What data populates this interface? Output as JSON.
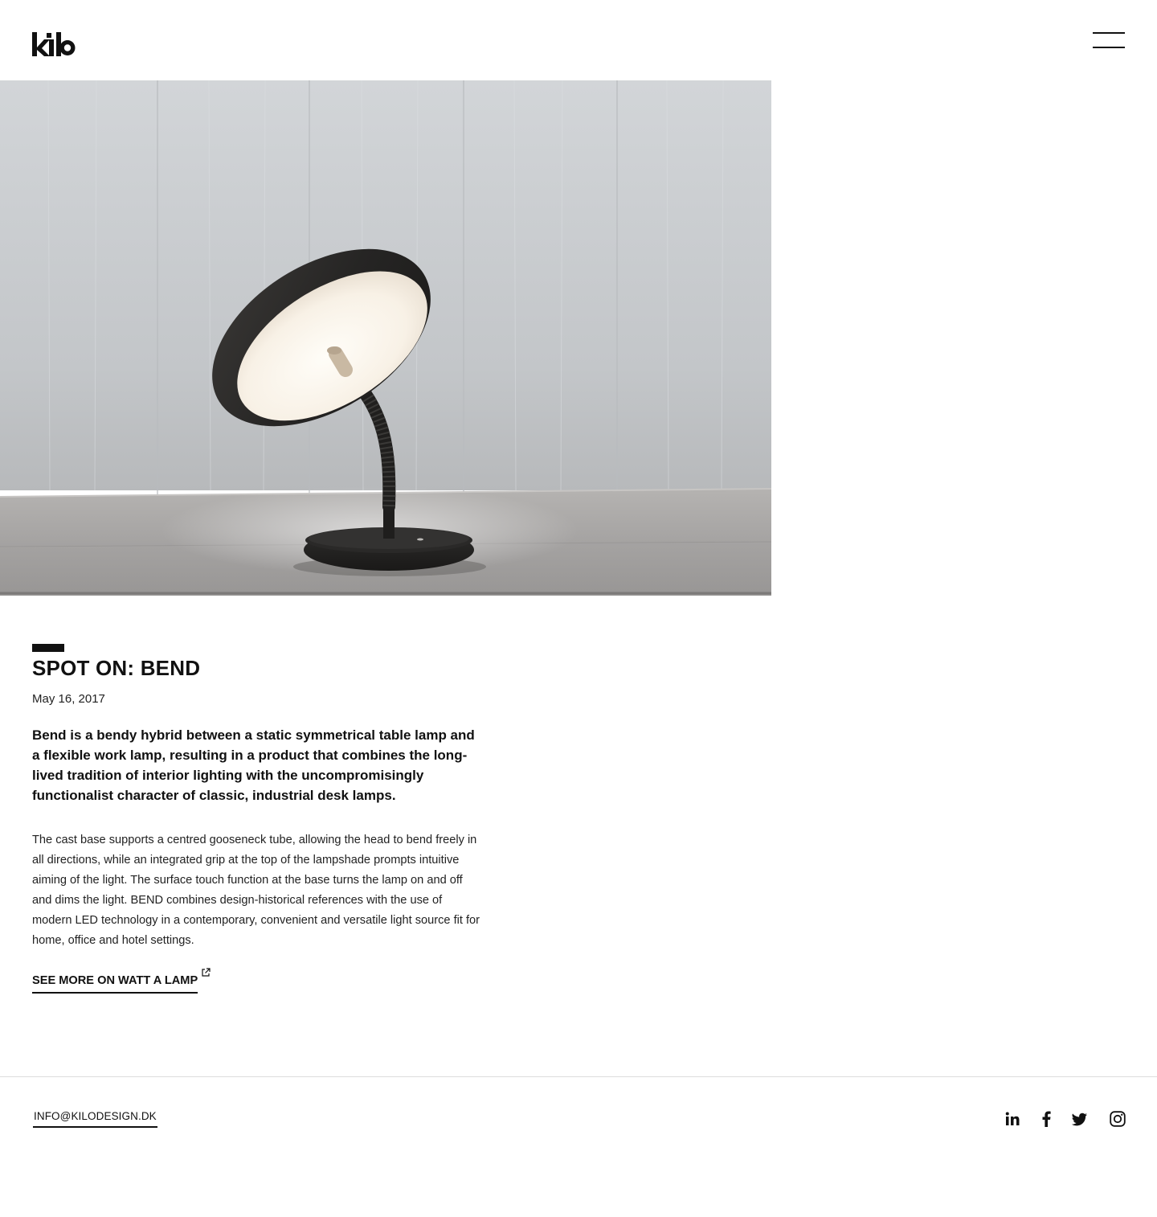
{
  "header": {
    "logo_text": "kilo",
    "menu_icon": "hamburger-icon"
  },
  "hero": {
    "image_subject": "black table lamp with gooseneck"
  },
  "article": {
    "title": "SPOT ON: BEND",
    "date": "May 16, 2017",
    "lead": "Bend is a bendy hybrid between a static symmetrical table lamp and a flexible work lamp, resulting in a product that combines the long-lived tradition of interior lighting with the uncompromisingly functionalist character of classic, industrial desk lamps.",
    "body": "The cast base supports a centred gooseneck tube, allowing the head to bend freely in all directions, while an integrated grip at the top of the lampshade prompts intuitive aiming of the light. The surface touch function at the base turns the lamp on and off and dims the light. BEND combines design-historical references with the use of modern LED technology in a contemporary, convenient and versatile light source fit for home, office and hotel settings.",
    "link_label": "SEE MORE ON WATT A LAMP",
    "link_icon": "external-link-icon"
  },
  "footer": {
    "email": "INFO@KILODESIGN.DK",
    "social": [
      {
        "name": "linkedin",
        "icon": "linkedin-icon"
      },
      {
        "name": "facebook",
        "icon": "facebook-icon"
      },
      {
        "name": "twitter",
        "icon": "twitter-icon"
      },
      {
        "name": "instagram",
        "icon": "instagram-icon"
      }
    ]
  },
  "colors": {
    "text": "#111111",
    "background": "#ffffff",
    "divider": "#dddddd",
    "hero_wall": "#c9ccce",
    "hero_table": "#a7a6a5",
    "lamp_body": "#262626",
    "lamp_light": "#fbf6ee"
  }
}
